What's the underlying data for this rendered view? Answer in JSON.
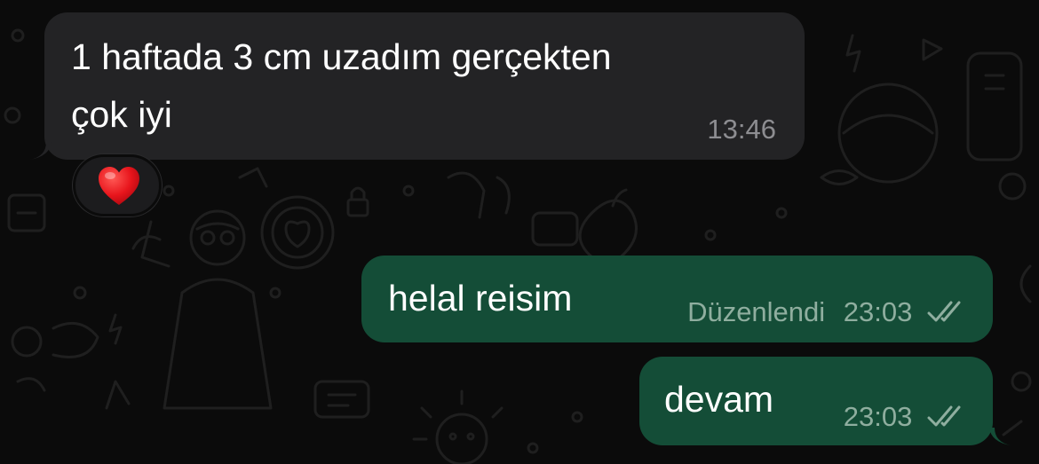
{
  "messages": [
    {
      "direction": "incoming",
      "lines": [
        "1 haftada 3 cm uzadım gerçekten",
        "çok iyi"
      ],
      "time": "13:46",
      "reaction": "❤️"
    },
    {
      "direction": "outgoing",
      "text": "helal reisim",
      "edited_label": "Düzenlendi",
      "time": "23:03",
      "status": "read"
    },
    {
      "direction": "outgoing",
      "text": "devam",
      "time": "23:03",
      "status": "read"
    }
  ],
  "icons": {
    "read_receipt": "double-check-icon",
    "reaction": "red-heart-emoji"
  },
  "colors": {
    "background": "#0b0b0b",
    "incoming_bubble": "#232325",
    "outgoing_bubble": "#144d37",
    "incoming_meta": "#8d8d91",
    "outgoing_meta": "#8fae9f",
    "doodle": "#1f1f1f"
  }
}
